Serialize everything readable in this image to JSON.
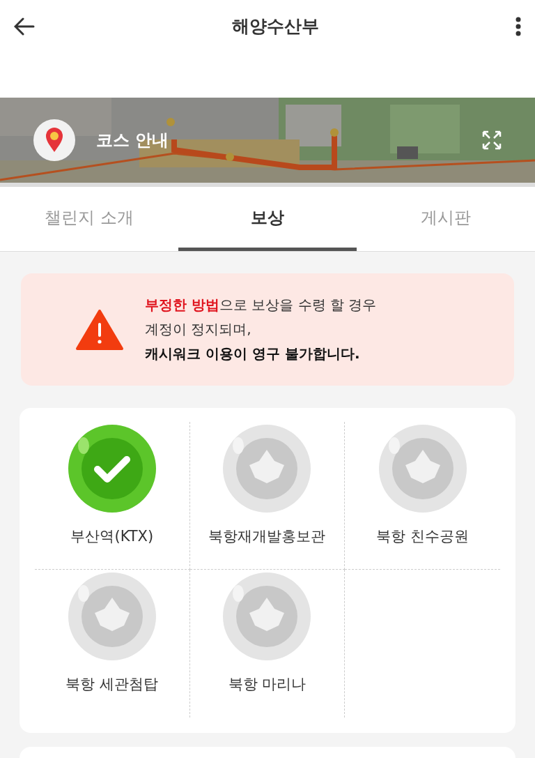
{
  "header": {
    "title": "해양수산부"
  },
  "course": {
    "label": "코스 안내"
  },
  "tabs": [
    {
      "label": "챌린지 소개",
      "selected": false
    },
    {
      "label": "보상",
      "selected": true
    },
    {
      "label": "게시판",
      "selected": false
    }
  ],
  "warning": {
    "lines": [
      "**부정한 방법**으로 보상을 수령 할 경우",
      "계정이 정지되며,",
      "**캐시워크 이용이 영구 불가합니다.**"
    ]
  },
  "stamps": [
    {
      "name": "부산역(KTX)",
      "collected": true
    },
    {
      "name": "북항재개발홍보관",
      "collected": false
    },
    {
      "name": "북항 친수공원",
      "collected": false
    },
    {
      "name": "북항 세관첨탑",
      "collected": false
    },
    {
      "name": "북항 마리나",
      "collected": false
    }
  ]
}
